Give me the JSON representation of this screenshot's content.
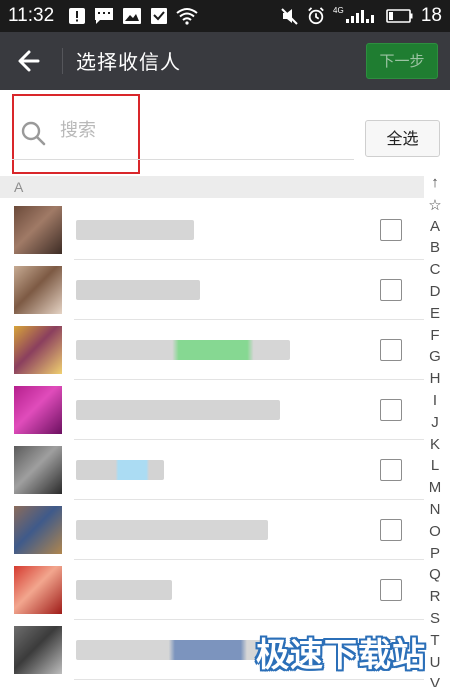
{
  "status_bar": {
    "time": "11:32",
    "battery_level": "18",
    "network_label": "4G",
    "icons": [
      "warning-icon",
      "message-icon",
      "image-icon",
      "inbox-icon",
      "wifi-icon",
      "mute-icon",
      "alarm-icon",
      "signal-icon",
      "battery-icon"
    ]
  },
  "header": {
    "title": "选择收信人",
    "next_label": "下一步"
  },
  "search": {
    "placeholder": "搜索",
    "select_all_label": "全选"
  },
  "section": {
    "letter": "A"
  },
  "contacts": [
    {
      "avatar_colors": [
        "#6b4a3a",
        "#a07a66",
        "#3d2c25"
      ],
      "name_colors": [
        "#c8c8c8"
      ],
      "checked": false
    },
    {
      "avatar_colors": [
        "#c7ab93",
        "#7d5a44",
        "#e5d3c4"
      ],
      "name_colors": [
        "#c4c4c4"
      ],
      "checked": false
    },
    {
      "avatar_colors": [
        "#d7a43a",
        "#8b3f5e",
        "#f0d070"
      ],
      "name_colors": [
        "#c8c8c8",
        "#5ecb6d"
      ],
      "checked": false
    },
    {
      "avatar_colors": [
        "#b51f8d",
        "#e04cbb",
        "#6c1060"
      ],
      "name_colors": [
        "#c6c6c6"
      ],
      "checked": false
    },
    {
      "avatar_colors": [
        "#5b5b5b",
        "#9f9f9f",
        "#2a2a2a"
      ],
      "name_colors": [
        "#c4c4c4",
        "#8fd0ef"
      ],
      "checked": false
    },
    {
      "avatar_colors": [
        "#8b6c5b",
        "#3f5a8a",
        "#b0864e"
      ],
      "name_colors": [
        "#c8c8c8"
      ],
      "checked": false
    },
    {
      "avatar_colors": [
        "#d53a30",
        "#f2a68e",
        "#9e1b18"
      ],
      "name_colors": [
        "#c6c6c6"
      ],
      "checked": false
    },
    {
      "avatar_colors": [
        "#6d6d6d",
        "#3b3b3b",
        "#bdbdbd"
      ],
      "name_colors": [
        "#c8c8c8",
        "#5071a8"
      ],
      "checked": false
    }
  ],
  "index_bar": [
    "↑",
    "☆",
    "A",
    "B",
    "C",
    "D",
    "E",
    "F",
    "G",
    "H",
    "I",
    "J",
    "K",
    "L",
    "M",
    "N",
    "O",
    "P",
    "Q",
    "R",
    "S",
    "T",
    "U",
    "V"
  ],
  "watermark": "极速下载站",
  "colors": {
    "title_bar": "#393a3f",
    "status_bar": "#1b1b1b",
    "next_button": "#1f7d31",
    "search_highlight": "#d9262a"
  }
}
